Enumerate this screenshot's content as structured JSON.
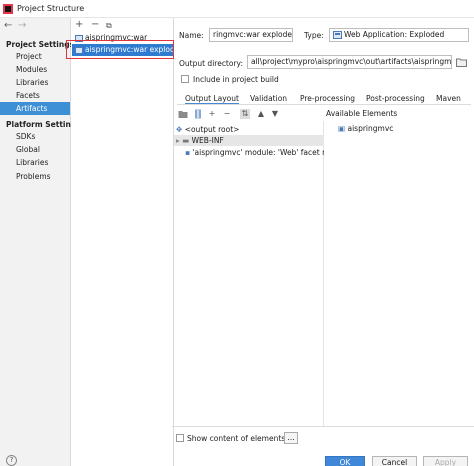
{
  "window": {
    "title": "Project Structure"
  },
  "sidebar": {
    "project_settings_header": "Project Settings",
    "project_items": [
      "Project",
      "Modules",
      "Libraries",
      "Facets",
      "Artifacts"
    ],
    "selected": "Artifacts",
    "platform_settings_header": "Platform Settings",
    "platform_items": [
      "SDKs",
      "Global Libraries"
    ],
    "problems": "Problems"
  },
  "artifacts": {
    "toolbar": {
      "add": "+",
      "remove": "−",
      "copy": "⧉"
    },
    "items": [
      "aispringmvc:war",
      "aispringmvc:war exploded"
    ],
    "selected_index": 1
  },
  "details": {
    "name_label": "Name:",
    "name_value": "ringmvc:war exploded",
    "type_label": "Type:",
    "type_value": "Web Application: Exploded",
    "output_dir_label": "Output directory:",
    "output_dir_value": "all\\project\\mypro\\aispringmvc\\out\\artifacts\\aispringmvc_w",
    "include_in_build": "Include in project build",
    "tabs": [
      "Output Layout",
      "Validation",
      "Pre-processing",
      "Post-processing",
      "Maven"
    ],
    "active_tab": "Output Layout"
  },
  "layout_tree": {
    "rows": [
      "<output root>",
      "WEB-INF",
      "'aispringmvc' module: 'Web' facet res"
    ],
    "available_header": "Available Elements",
    "available_items": [
      "aispringmvc"
    ]
  },
  "footer": {
    "show_content": "Show content of elements",
    "ellipsis": "...",
    "help": "?",
    "ok": "OK",
    "cancel": "Cancel",
    "apply": "Apply"
  },
  "colors": {
    "selection": "#3d8fd6",
    "highlight_box": "#e0343c",
    "ok_button": "#3f87d8"
  }
}
